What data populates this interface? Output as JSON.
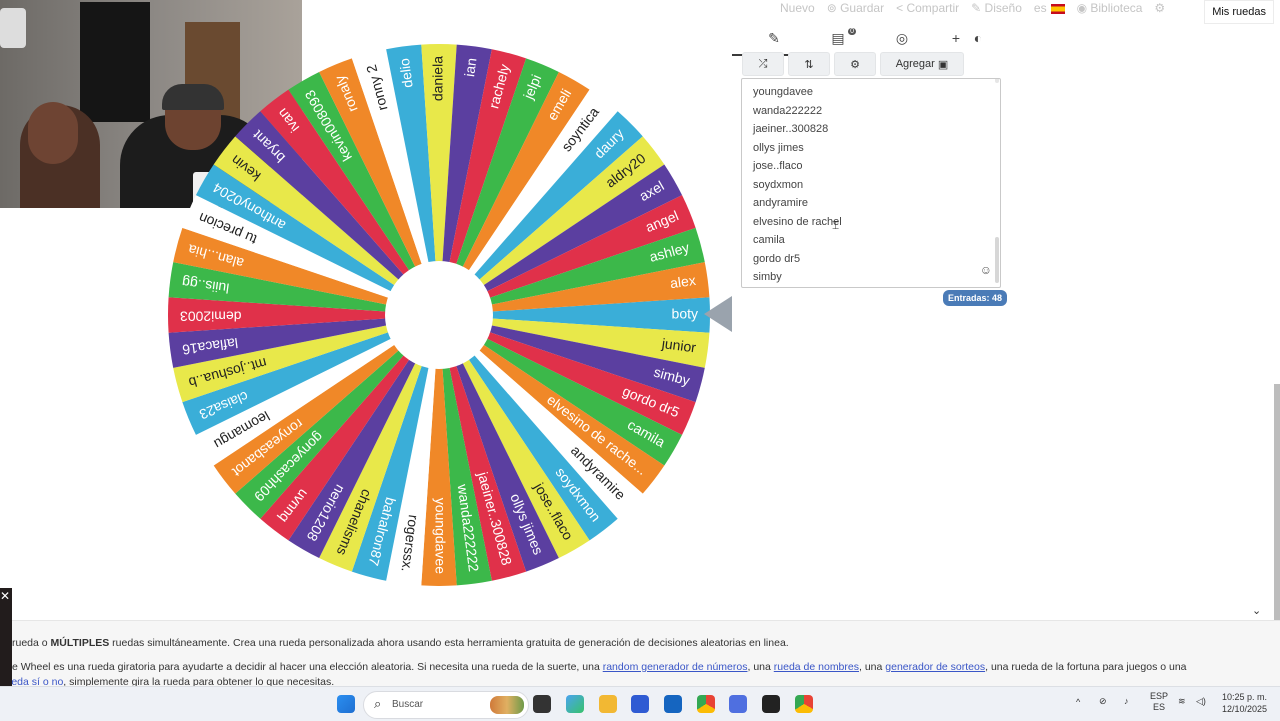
{
  "top_menu": {
    "nuevo": "Nuevo",
    "guardar": "Guardar",
    "compartir": "Compartir",
    "diseno": "Diseño",
    "lang": "es",
    "biblioteca": "Biblioteca",
    "mis_ruedas": "Mis ruedas"
  },
  "wheel": {
    "segments": [
      "boty",
      "junior",
      "simby",
      "gordo dr5",
      "camila",
      "elvesino de rache...",
      "andyramire",
      "soydxmon",
      "jose..flaco",
      "ollys jimes",
      "jaeiner..300828",
      "wanda222222",
      "youngdavee",
      "rogerssx.",
      "bahalron87",
      "chanelisms",
      "nerio1208",
      "uvnnq",
      "gonyecashh09",
      "ronyeasbanot",
      "leomangu",
      "claisa23",
      "mt..joshua..b",
      "laflaca16",
      "demi2003",
      "luiis..gg",
      "alan...hia",
      "tu precion",
      "anthony0204",
      "kevin",
      "bryant",
      "ivan",
      "kevin008093",
      "ronaly",
      "ronny 2",
      "delio",
      "daniela",
      "ian",
      "rachely",
      "jelpi",
      "emeli",
      "soyntica",
      "daury",
      "aldry20",
      "axel",
      "angel",
      "ashley",
      "alex"
    ],
    "colors": [
      "#3aaed8",
      "#e8e84a",
      "#5b3fa0",
      "#e0314a",
      "#3cb84a",
      "#f08828",
      "#ffffff"
    ]
  },
  "toolbar": {
    "agregar": "Agregar"
  },
  "entries": {
    "visible": [
      "youngdavee",
      "wanda222222",
      "jaeiner..300828",
      "ollys jimes",
      "jose..flaco",
      "soydxmon",
      "andyramire",
      "elvesino de rachel",
      "camila",
      "gordo dr5",
      "simby"
    ],
    "count_label": "Entradas: 48"
  },
  "info": {
    "p1_prefix": "rueda o ",
    "p1_bold": "MÚLTIPLES",
    "p1_rest": " ruedas simultáneamente. Crea una rueda personalizada ahora usando esta herramienta gratuita de generación de decisiones aleatorias en linea.",
    "p2_a": "e Wheel es una rueda giratoria para ayudarte a decidir al hacer una elección aleatoria. Si necesita una rueda de la suerte, una ",
    "p2_link1": "random generador de números",
    "p2_b": ", una ",
    "p2_link2": "rueda de nombres",
    "p2_c": ", una ",
    "p2_link3": "generador de sorteos",
    "p2_d": ", una rueda de la fortuna para juegos o una",
    "p3_link": "rueda sí o no",
    "p3_rest": ", simplemente gira la rueda para obtener lo que necesitas."
  },
  "taskbar": {
    "search_placeholder": "Buscar",
    "lang_top": "ESP",
    "lang_bottom": "ES",
    "time": "10:25 p. m.",
    "date": "12/10/2025"
  }
}
